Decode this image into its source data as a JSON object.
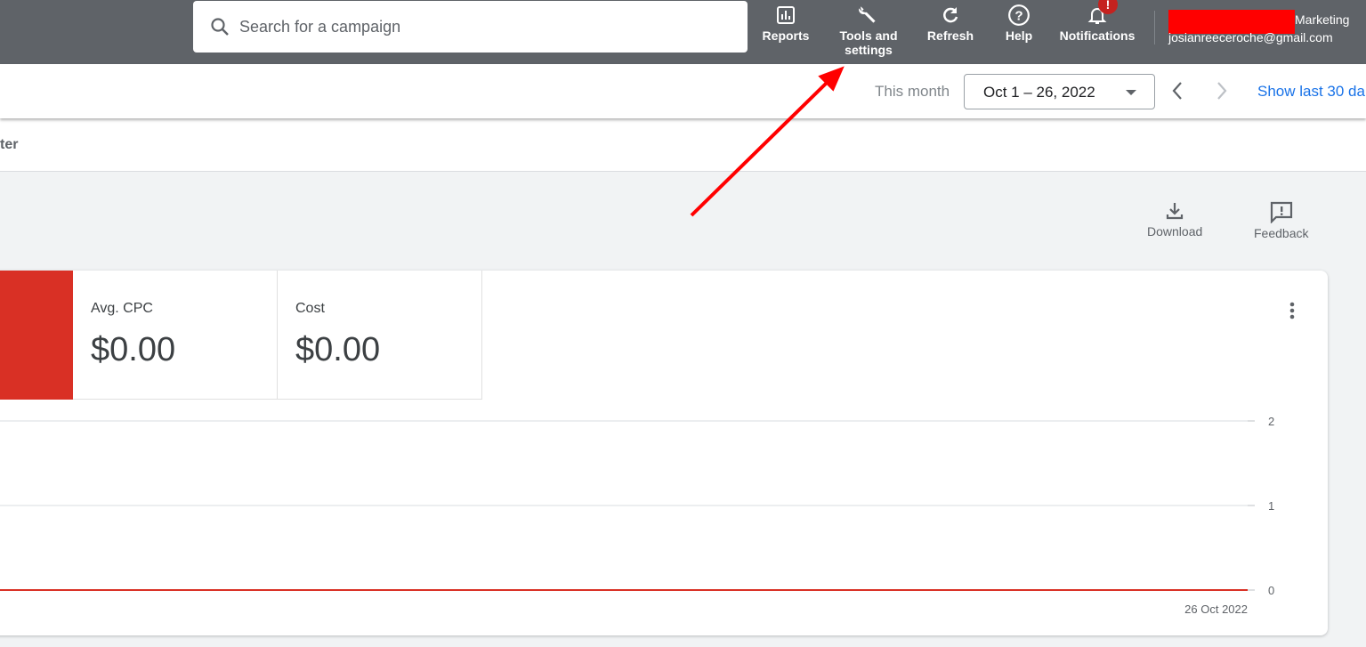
{
  "topbar": {
    "search_placeholder": "Search for a campaign",
    "buttons": [
      {
        "label": "Reports",
        "icon": "reports-icon"
      },
      {
        "label": "Tools and settings",
        "icon": "wrench-icon"
      },
      {
        "label": "Refresh",
        "icon": "refresh-icon"
      },
      {
        "label": "Help",
        "icon": "help-icon"
      },
      {
        "label": "Notifications",
        "icon": "bell-icon",
        "badge": "!"
      }
    ],
    "account_name_partial": "Marketing",
    "account_email": "josianreeceroche@gmail.com"
  },
  "daterow": {
    "preset": "This month",
    "range": "Oct 1 – 26, 2022",
    "show_last": "Show last 30 da"
  },
  "filterrow": {
    "text": "ter"
  },
  "actions": {
    "download": "Download",
    "feedback": "Feedback"
  },
  "scorecards": [
    {
      "label": "Avg. CPC",
      "value": "$0.00"
    },
    {
      "label": "Cost",
      "value": "$0.00"
    }
  ],
  "colors": {
    "topbar": "#5f6368",
    "accent_red": "#d93025",
    "link": "#1a73e8"
  },
  "chart_data": {
    "type": "line",
    "x": [
      "26 Oct 2022"
    ],
    "series": [
      {
        "values": [
          0
        ],
        "color": "#d93025"
      }
    ],
    "yticks": [
      "0",
      "1",
      "2"
    ],
    "ylim": [
      0,
      2
    ],
    "xlabel_shown": "26 Oct 2022",
    "grid": true
  }
}
